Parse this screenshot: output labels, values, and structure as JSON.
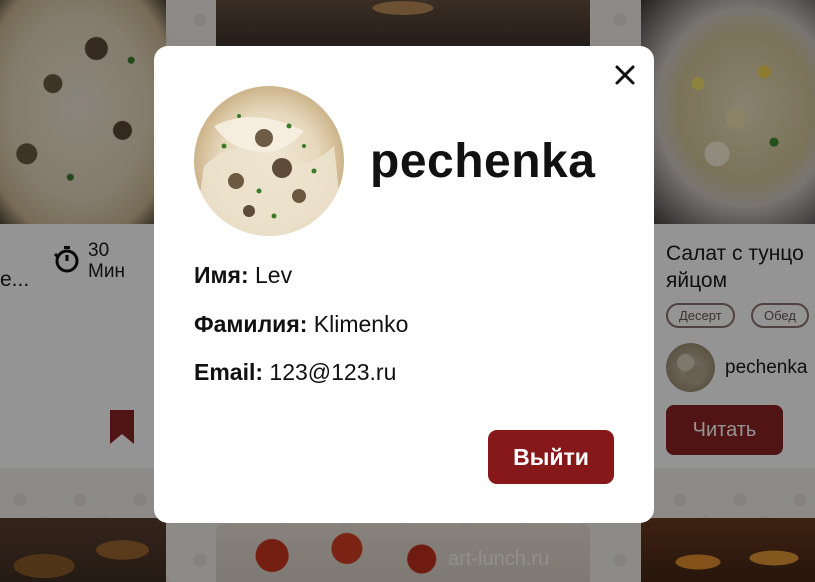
{
  "background": {
    "left_card": {
      "title_fragment": "е...",
      "time_value": "30",
      "time_unit": "Мин"
    },
    "right_card": {
      "title_line1": "Салат с тунцо",
      "title_line2": "яйцом",
      "tags": [
        "Десерт",
        "Обед"
      ],
      "author": "pechenka",
      "read_label": "Читать"
    },
    "watermark": "art-lunch.ru"
  },
  "profile_modal": {
    "username": "pechenka",
    "fields": {
      "first_name_label": "Имя:",
      "first_name_value": "Lev",
      "last_name_label": "Фамилия:",
      "last_name_value": "Klimenko",
      "email_label": "Email:",
      "email_value": "123@123.ru"
    },
    "logout_label": "Выйти",
    "close_icon": "close-icon"
  },
  "colors": {
    "accent": "#861819",
    "overlay": "rgba(0,0,0,0.42)",
    "modal_bg": "#ffffff"
  }
}
